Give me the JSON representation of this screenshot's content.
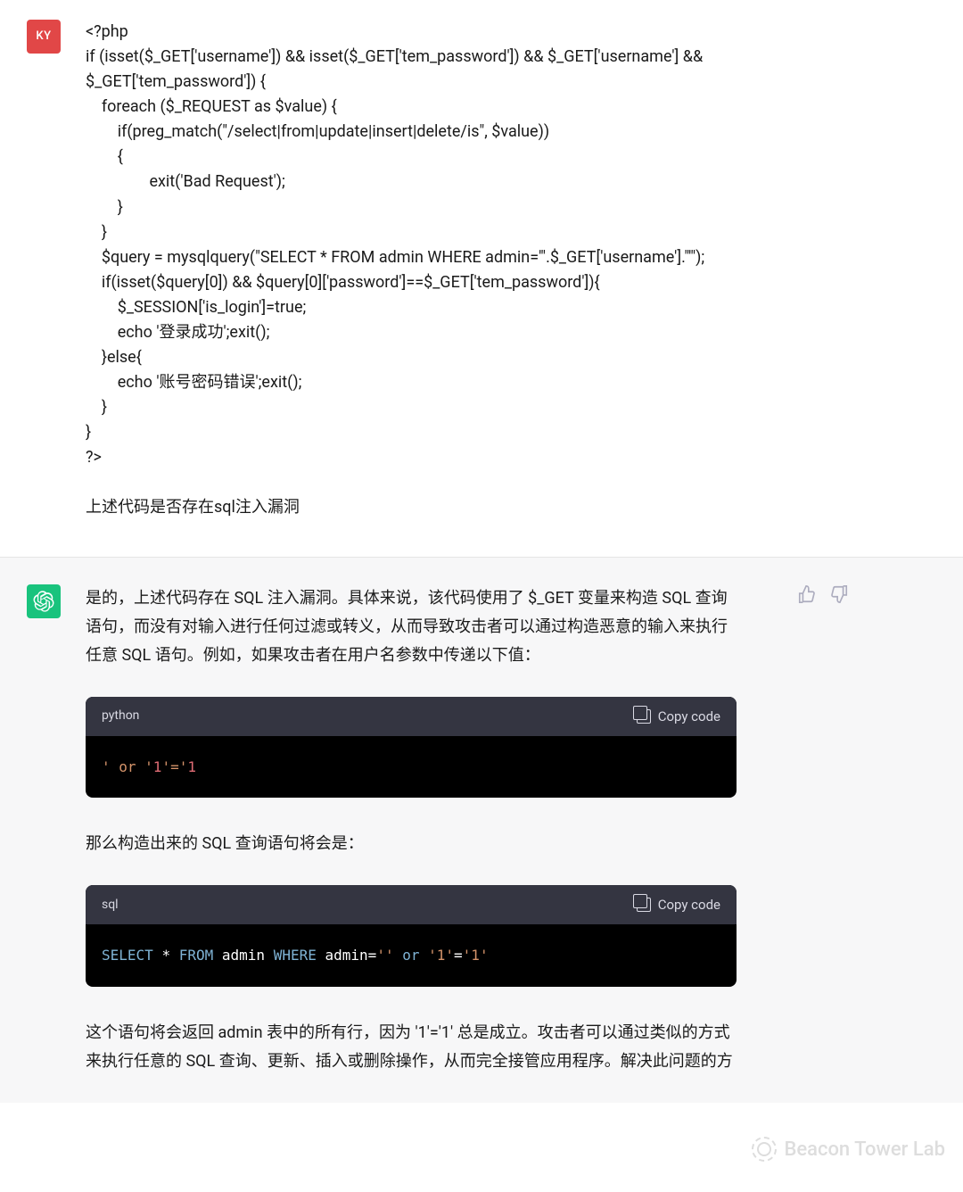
{
  "user": {
    "avatar_initials": "KY",
    "message": "<?php\nif (isset($_GET['username']) && isset($_GET['tem_password']) && $_GET['username'] && $_GET['tem_password']) {\n    foreach ($_REQUEST as $value) {\n        if(preg_match(\"/select|from|update|insert|delete/is\", $value))\n        {\n                exit('Bad Request');\n        }\n    }\n    $query = mysqlquery(\"SELECT * FROM admin WHERE admin='\".$_GET['username'].\"'\");\n    if(isset($query[0]) && $query[0]['password']==$_GET['tem_password']){\n        $_SESSION['is_login']=true;\n        echo '登录成功';exit();\n    }else{\n        echo '账号密码错误';exit();\n    }\n}\n?>\n\n上述代码是否存在sql注入漏洞"
  },
  "assistant": {
    "paragraphs": {
      "p1": "是的，上述代码存在 SQL 注入漏洞。具体来说，该代码使用了 $_GET 变量来构造 SQL 查询语句，而没有对输入进行任何过滤或转义，从而导致攻击者可以通过构造恶意的输入来执行任意 SQL 语句。例如，如果攻击者在用户名参数中传递以下值：",
      "p2": "那么构造出来的 SQL 查询语句将会是：",
      "p3": "这个语句将会返回 admin 表中的所有行，因为 '1'='1' 总是成立。攻击者可以通过类似的方式来执行任意的 SQL 查询、更新、插入或删除操作，从而完全接管应用程序。解决此问题的方"
    },
    "code1": {
      "lang": "python",
      "copy_label": "Copy code",
      "content": "' or '1'='1"
    },
    "code2": {
      "lang": "sql",
      "copy_label": "Copy code",
      "content": "SELECT * FROM admin WHERE admin='' or '1'='1'"
    }
  },
  "watermark": "Beacon Tower Lab"
}
